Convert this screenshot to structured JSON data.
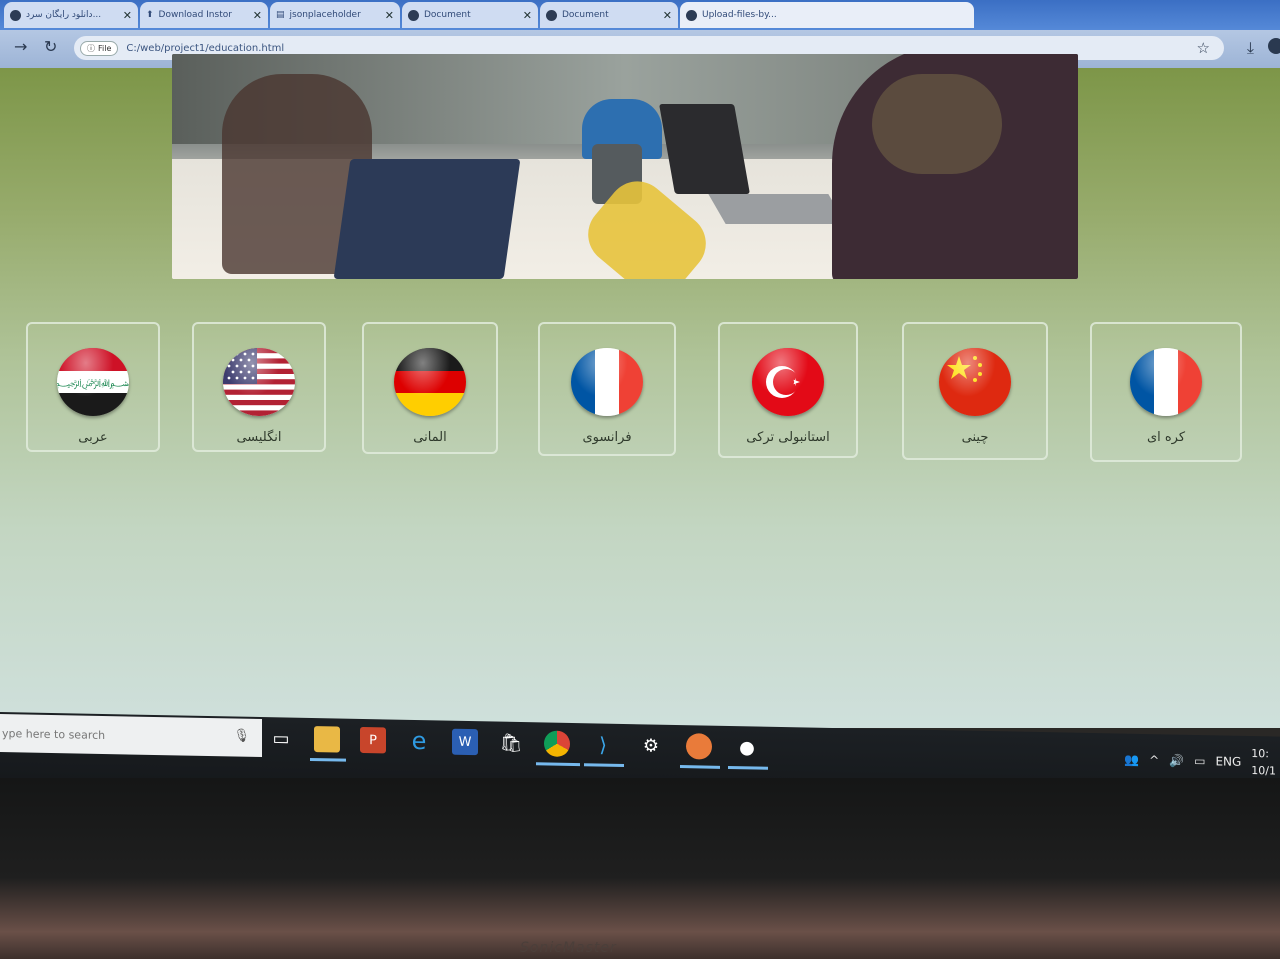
{
  "browser": {
    "tabs": [
      {
        "label": "دانلود رایگان سرد..."
      },
      {
        "label": "Download Instor"
      },
      {
        "label": "jsonplaceholder"
      },
      {
        "label": "Document"
      },
      {
        "label": "Document"
      },
      {
        "label": "Upload-files-by..."
      }
    ],
    "chip_label": "File",
    "url": "C:/web/project1/education.html"
  },
  "cards": [
    {
      "label": "عربی",
      "flag": "iraq-flag-icon"
    },
    {
      "label": "انگلیسی",
      "flag": "usa-flag-icon"
    },
    {
      "label": "المانی",
      "flag": "germany-flag-icon"
    },
    {
      "label": "فرانسوی",
      "flag": "france-flag-icon"
    },
    {
      "label": "استانبولی ترکی",
      "flag": "turkey-flag-icon"
    },
    {
      "label": "چینی",
      "flag": "china-flag-icon"
    },
    {
      "label": "کره ای",
      "flag": "france-flag-icon"
    }
  ],
  "taskbar": {
    "search_placeholder": "ype here to search",
    "language": "ENG",
    "time": "10:",
    "date": "10/1"
  },
  "bezel": {
    "brand": "SonicMaster"
  }
}
